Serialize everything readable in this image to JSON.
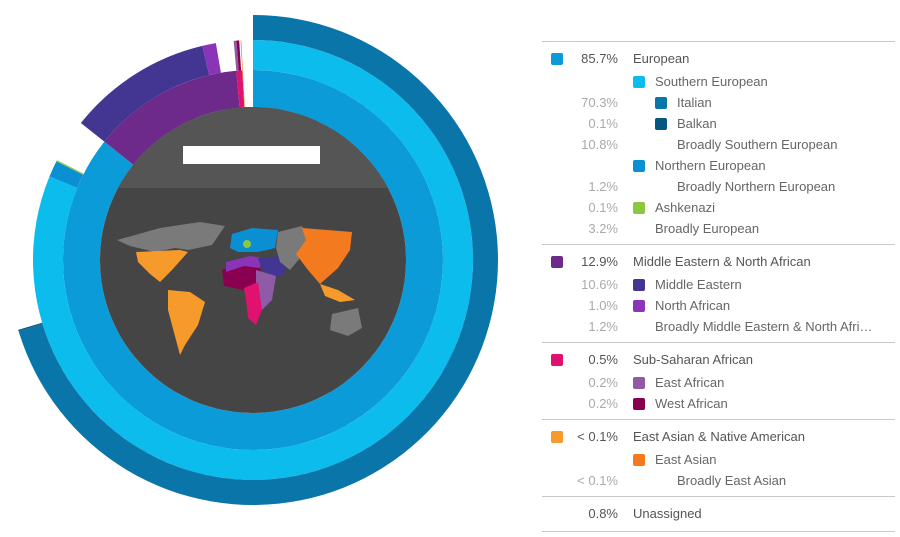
{
  "chart_data": {
    "type": "pie",
    "title": "",
    "groups": [
      {
        "label": "European",
        "pct": "85.7%",
        "value": 85.7,
        "color": "#0c9bd9",
        "children": [
          {
            "label": "Southern European",
            "pct": "",
            "value": 81.2,
            "color": "#0bbcec",
            "children": [
              {
                "label": "Italian",
                "pct": "70.3%",
                "value": 70.3,
                "color": "#0a75a8"
              },
              {
                "label": "Balkan",
                "pct": "0.1%",
                "value": 0.1,
                "color": "#07567f"
              },
              {
                "label": "Broadly Southern European",
                "pct": "10.8%",
                "value": 10.8,
                "color": null
              }
            ]
          },
          {
            "label": "Northern European",
            "pct": "",
            "value": 1.2,
            "color": "#0a8fd3",
            "children": [
              {
                "label": "Broadly Northern European",
                "pct": "1.2%",
                "value": 1.2,
                "color": null
              }
            ]
          },
          {
            "label": "Ashkenazi",
            "pct": "0.1%",
            "value": 0.1,
            "color": "#8dc63f"
          },
          {
            "label": "Broadly European",
            "pct": "3.2%",
            "value": 3.2,
            "color": null
          }
        ]
      },
      {
        "label": "Middle Eastern & North African",
        "pct": "12.9%",
        "value": 12.9,
        "color": "#6e2a8a",
        "children": [
          {
            "label": "Middle Eastern",
            "pct": "10.6%",
            "value": 10.6,
            "color": "#433592"
          },
          {
            "label": "North African",
            "pct": "1.0%",
            "value": 1.0,
            "color": "#8a35b8"
          },
          {
            "label": "Broadly Middle Eastern & North Afri…",
            "pct": "1.2%",
            "value": 1.2,
            "color": null
          }
        ]
      },
      {
        "label": "Sub-Saharan African",
        "pct": "0.5%",
        "value": 0.5,
        "color": "#e0116f",
        "children": [
          {
            "label": "East African",
            "pct": "0.2%",
            "value": 0.2,
            "color": "#8f5aa6"
          },
          {
            "label": "West African",
            "pct": "0.2%",
            "value": 0.2,
            "color": "#8a0050"
          }
        ]
      },
      {
        "label": "East Asian & Native American",
        "pct": "< 0.1%",
        "value": 0.05,
        "color": "#f59a2b",
        "children": [
          {
            "label": "East Asian",
            "pct": "",
            "value": 0.05,
            "color": "#f47a20",
            "children": [
              {
                "label": "Broadly East Asian",
                "pct": "< 0.1%",
                "value": 0.05,
                "color": null
              }
            ]
          }
        ]
      },
      {
        "label": "Unassigned",
        "pct": "0.8%",
        "value": 0.8,
        "color": null
      }
    ]
  },
  "map": {
    "land_color": "#7a7a7a",
    "disk_top": "#555555",
    "disk_bottom": "#454545"
  }
}
